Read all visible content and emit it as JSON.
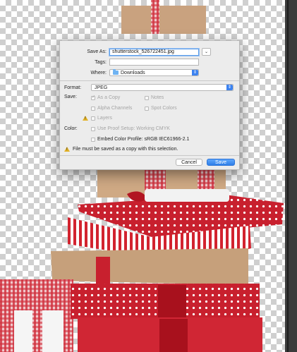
{
  "dialog": {
    "save_as_label": "Save As:",
    "filename": "shutterstock_526722451.jpg",
    "tags_label": "Tags:",
    "tags_value": "",
    "where_label": "Where:",
    "where_value": "Downloads",
    "format_label": "Format:",
    "format_value": "JPEG",
    "save_label": "Save:",
    "as_a_copy": "As a Copy",
    "notes": "Notes",
    "alpha_channels": "Alpha Channels",
    "spot_colors": "Spot Colors",
    "layers": "Layers",
    "color_label": "Color:",
    "use_proof_setup": "Use Proof Setup:  Working CMYK",
    "embed_color_profile": "Embed Color Profile:  sRGB IEC61966-2.1",
    "warning_message": "File must be saved as a copy with this selection.",
    "cancel_button": "Cancel",
    "save_button": "Save"
  },
  "icons": {
    "expand": "chevron-down-icon",
    "folder": "folder-icon",
    "warning": "warning-icon"
  },
  "colors": {
    "accent": "#3b82f0",
    "gift_red": "#c8202e",
    "kraft": "#c9a27f",
    "warning": "#e2b227"
  }
}
